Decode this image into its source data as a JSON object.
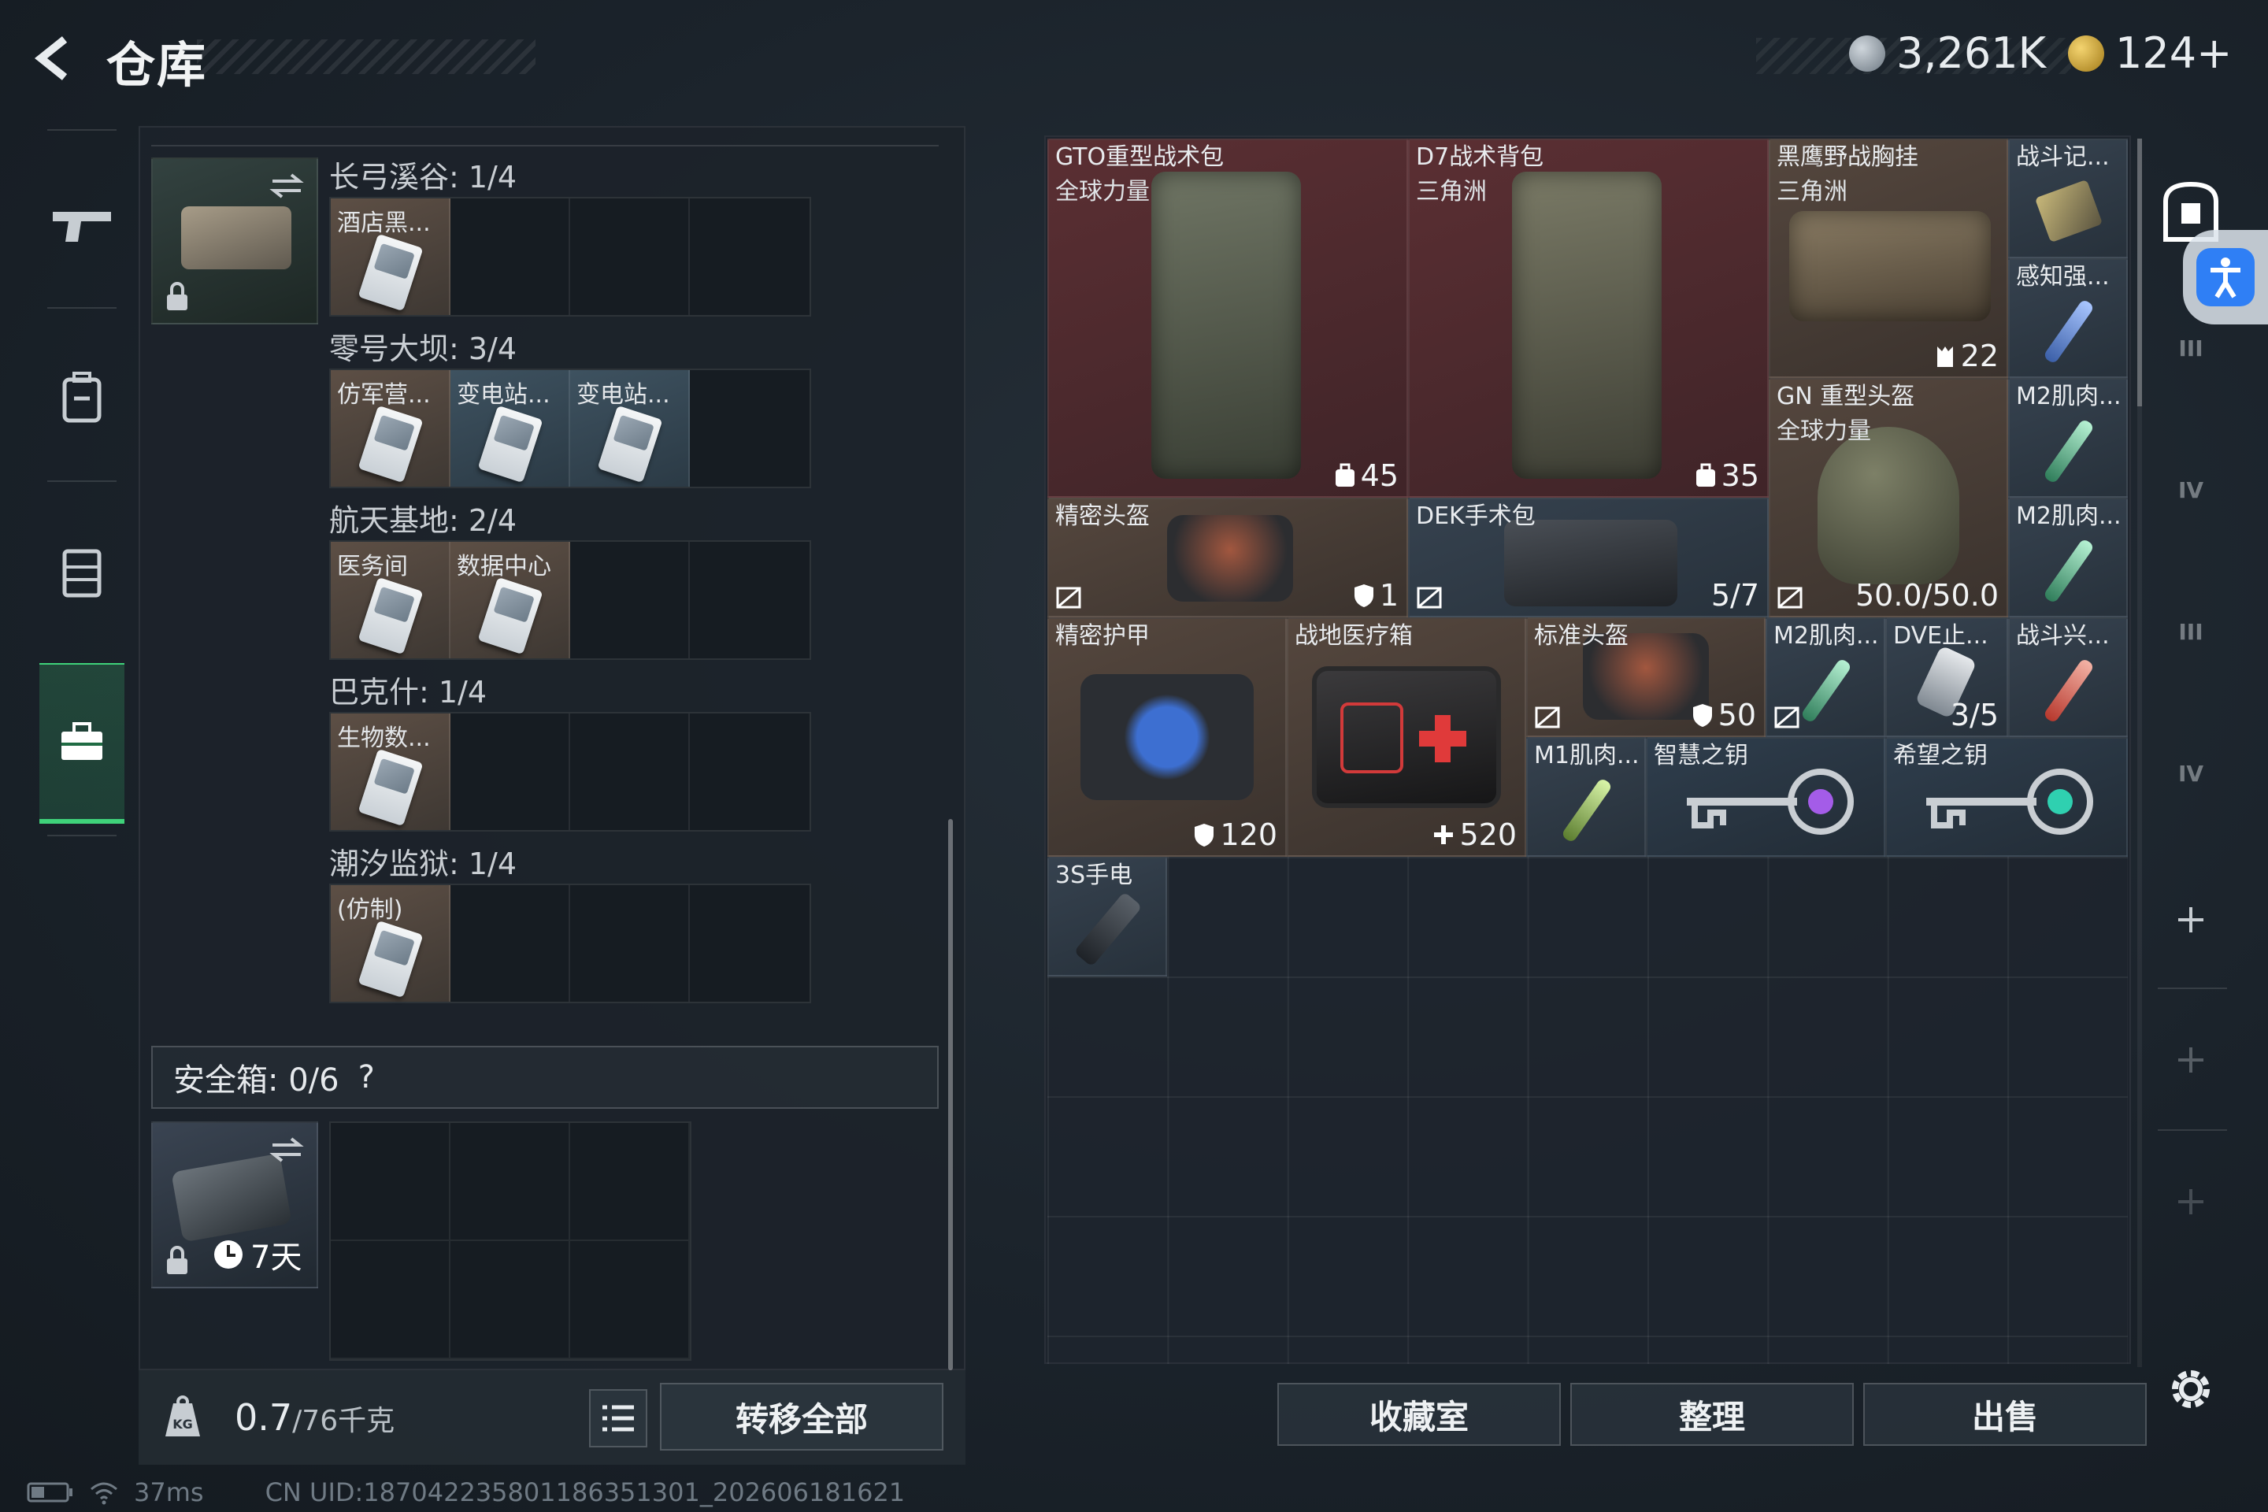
{
  "header": {
    "title": "仓库",
    "currency_primary": "3,261K",
    "currency_secondary": "124+"
  },
  "sidebar": {
    "tabs": [
      {
        "icon": "gun-icon",
        "active": false
      },
      {
        "icon": "backpack-icon",
        "active": false
      },
      {
        "icon": "vest-icon",
        "active": false
      },
      {
        "icon": "briefcase-icon",
        "active": true
      }
    ]
  },
  "keycase": {
    "groups": [
      {
        "label": "长弓溪谷: 1/4",
        "slots": [
          "酒店黑..."
        ]
      },
      {
        "label": "零号大坝: 3/4",
        "slots": [
          "仿军营...",
          "变电站...",
          "变电站..."
        ]
      },
      {
        "label": "航天基地: 2/4",
        "slots": [
          "医务间",
          "数据中心"
        ]
      },
      {
        "label": "巴克什: 1/4",
        "slots": [
          "生物数..."
        ]
      },
      {
        "label": "潮汐监狱: 1/4",
        "slots": [
          "(仿制)"
        ]
      }
    ]
  },
  "safe_box": {
    "label": "安全箱: 0/6",
    "help": "?",
    "timer": "7天"
  },
  "footer_left": {
    "weight_value": "0.7",
    "weight_max": "/76千克",
    "transfer_all": "转移全部"
  },
  "items": {
    "gto": {
      "name": "GTO重型战术包",
      "sub": "全球力量",
      "value": "45"
    },
    "d7": {
      "name": "D7战术背包",
      "sub": "三角洲",
      "value": "35"
    },
    "blackeagle": {
      "name": "黑鹰野战胸挂",
      "sub": "三角洲",
      "value": "22"
    },
    "record": {
      "name": "战斗记..."
    },
    "perception": {
      "name": "感知强..."
    },
    "gn_helmet": {
      "name": "GN 重型头盔",
      "sub": "全球力量",
      "value": "50.0/50.0"
    },
    "m2a": {
      "name": "M2肌肉..."
    },
    "m2b": {
      "name": "M2肌肉..."
    },
    "precise_helmet": {
      "name": "精密头盔",
      "value": "1"
    },
    "dek": {
      "name": "DEK手术包",
      "value": "5/7"
    },
    "precise_armor": {
      "name": "精密护甲",
      "value": "120"
    },
    "medkit": {
      "name": "战地医疗箱",
      "value": "520"
    },
    "std_helmet": {
      "name": "标准头盔",
      "value": "50"
    },
    "m2c": {
      "name": "M2肌肉..."
    },
    "dve": {
      "name": "DVE止...",
      "value": "3/5"
    },
    "combat_stim": {
      "name": "战斗兴..."
    },
    "m1": {
      "name": "M1肌肉..."
    },
    "wisdom_key": {
      "name": "智慧之钥"
    },
    "hope_key": {
      "name": "希望之钥"
    },
    "flashlight": {
      "name": "3S手电"
    }
  },
  "footer_right": {
    "collection": "收藏室",
    "organize": "整理",
    "sell": "出售"
  },
  "right_rail": {
    "levels": [
      "III",
      "IV",
      "III",
      "IV"
    ]
  },
  "status": {
    "ping": "37ms",
    "uid": "CN UID:187042235801186351301_202606181621"
  }
}
